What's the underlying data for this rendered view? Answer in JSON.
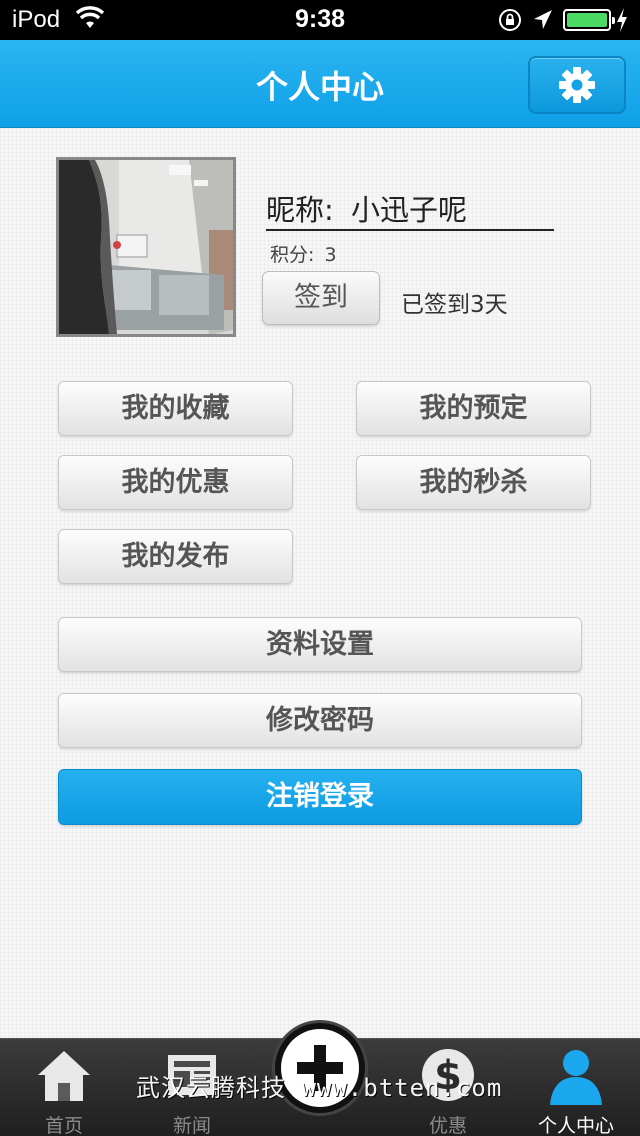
{
  "status_bar": {
    "carrier": "iPod",
    "time": "9:38",
    "battery_level": 1.0,
    "icons": [
      "wifi-icon",
      "orientation-lock-icon",
      "location-arrow-icon",
      "battery-icon",
      "charging-bolt-icon"
    ]
  },
  "header": {
    "title": "个人中心",
    "settings_icon": "gear-icon"
  },
  "profile": {
    "nickname_label": "昵称:",
    "nickname": "小迅子呢",
    "points_label": "积分:",
    "points": "3",
    "signin_label": "签到",
    "signed_days_text": "已签到3天"
  },
  "menu": {
    "favorites": "我的收藏",
    "reservations": "我的预定",
    "discounts": "我的优惠",
    "flash_sales": "我的秒杀",
    "posts": "我的发布"
  },
  "actions": {
    "profile_settings": "资料设置",
    "change_password": "修改密码",
    "logout": "注销登录"
  },
  "tabbar": {
    "tabs": [
      {
        "label": "首页",
        "icon": "home-icon"
      },
      {
        "label": "新闻",
        "icon": "news-icon"
      },
      {
        "label": "",
        "icon": "plus-icon"
      },
      {
        "label": "优惠",
        "icon": "dollar-icon"
      },
      {
        "label": "个人中心",
        "icon": "user-icon"
      }
    ],
    "active_index": 4
  },
  "watermark": "武汉云腾科技 www.btten.com",
  "colors": {
    "accent": "#14a4e8",
    "battery": "#4cd964",
    "tabbar": "#2a2a2a"
  }
}
